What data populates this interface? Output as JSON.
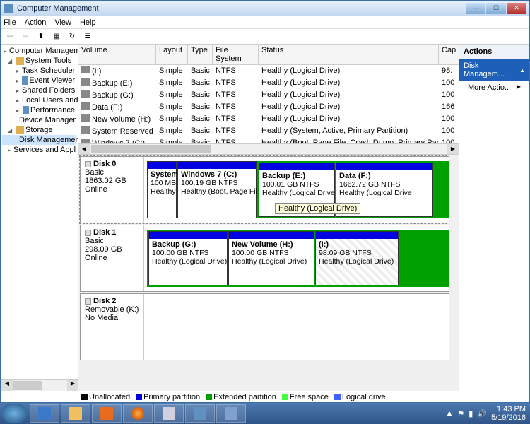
{
  "window": {
    "title": "Computer Management"
  },
  "menu": [
    "File",
    "Action",
    "View",
    "Help"
  ],
  "toolbar_icons": [
    "back",
    "forward",
    "up",
    "props",
    "refresh",
    "list",
    "help"
  ],
  "tree": {
    "root": "Computer Managem",
    "system_tools": "System Tools",
    "items_st": [
      "Task Scheduler",
      "Event Viewer",
      "Shared Folders",
      "Local Users and",
      "Performance",
      "Device Manager"
    ],
    "storage": "Storage",
    "disk_mgmt": "Disk Management",
    "services": "Services and Appl"
  },
  "vol_headers": [
    "Volume",
    "Layout",
    "Type",
    "File System",
    "Status",
    "Cap"
  ],
  "volumes": [
    {
      "name": "(I:)",
      "layout": "Simple",
      "type": "Basic",
      "fs": "NTFS",
      "status": "Healthy (Logical Drive)",
      "cap": "98."
    },
    {
      "name": "Backup (E:)",
      "layout": "Simple",
      "type": "Basic",
      "fs": "NTFS",
      "status": "Healthy (Logical Drive)",
      "cap": "100"
    },
    {
      "name": "Backup (G:)",
      "layout": "Simple",
      "type": "Basic",
      "fs": "NTFS",
      "status": "Healthy (Logical Drive)",
      "cap": "100"
    },
    {
      "name": "Data (F:)",
      "layout": "Simple",
      "type": "Basic",
      "fs": "NTFS",
      "status": "Healthy (Logical Drive)",
      "cap": "166"
    },
    {
      "name": "New Volume (H:)",
      "layout": "Simple",
      "type": "Basic",
      "fs": "NTFS",
      "status": "Healthy (Logical Drive)",
      "cap": "100"
    },
    {
      "name": "System Reserved",
      "layout": "Simple",
      "type": "Basic",
      "fs": "NTFS",
      "status": "Healthy (System, Active, Primary Partition)",
      "cap": "100"
    },
    {
      "name": "Windows 7 (C:)",
      "layout": "Simple",
      "type": "Basic",
      "fs": "NTFS",
      "status": "Healthy (Boot, Page File, Crash Dump, Primary Partition)",
      "cap": "100"
    }
  ],
  "disks": [
    {
      "name": "Disk 0",
      "type": "Basic",
      "size": "1863.02 GB",
      "state": "Online",
      "parts": [
        {
          "label": "System",
          "size": "100 MB",
          "status": "Healthy",
          "w": 42,
          "kind": "pri"
        },
        {
          "label": "Windows 7  (C:)",
          "size": "100.19 GB NTFS",
          "status": "Healthy (Boot, Page Fil",
          "w": 112,
          "kind": "pri"
        },
        {
          "label": "Backup  (E:)",
          "size": "100.01 GB NTFS",
          "status": "Healthy (Logical Drive",
          "w": 108,
          "kind": "log"
        },
        {
          "label": "Data  (F:)",
          "size": "1662.72 GB NTFS",
          "status": "Healthy (Logical Drive",
          "w": 138,
          "kind": "log"
        }
      ],
      "tooltip": "Healthy (Logical Drive)"
    },
    {
      "name": "Disk 1",
      "type": "Basic",
      "size": "298.09 GB",
      "state": "Online",
      "parts": [
        {
          "label": "Backup  (G:)",
          "size": "100.00 GB NTFS",
          "status": "Healthy (Logical Drive)",
          "w": 112,
          "kind": "log"
        },
        {
          "label": "New Volume  (H:)",
          "size": "100.00 GB NTFS",
          "status": "Healthy (Logical Drive)",
          "w": 122,
          "kind": "log"
        },
        {
          "label": "(I:)",
          "size": "98.09 GB NTFS",
          "status": "Healthy (Logical Drive)",
          "w": 118,
          "kind": "log",
          "hatch": true
        }
      ]
    },
    {
      "name": "Disk 2",
      "type": "Removable (K:)",
      "size": "",
      "state": "No Media",
      "parts": []
    }
  ],
  "legend": [
    {
      "c": "#000",
      "t": "Unallocated"
    },
    {
      "c": "#0000e0",
      "t": "Primary partition"
    },
    {
      "c": "#00a000",
      "t": "Extended partition"
    },
    {
      "c": "#40ff40",
      "t": "Free space"
    },
    {
      "c": "#4060ff",
      "t": "Logical drive"
    }
  ],
  "actions": {
    "title": "Actions",
    "section": "Disk Managem...",
    "more": "More Actio..."
  },
  "clock": {
    "time": "1:43 PM",
    "date": "5/19/2016"
  }
}
